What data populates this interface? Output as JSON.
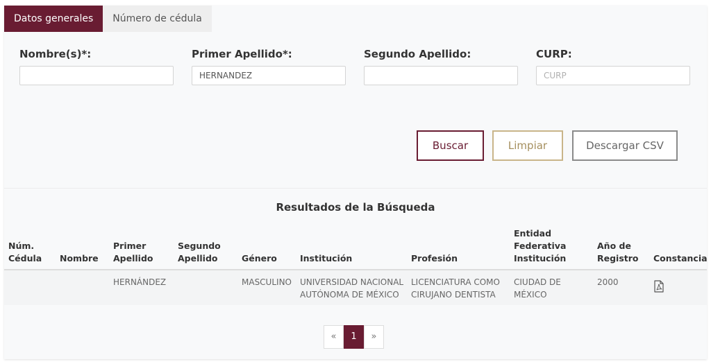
{
  "tabs": [
    {
      "label": "Datos generales",
      "active": true
    },
    {
      "label": "Número de cédula",
      "active": false
    }
  ],
  "form": {
    "nombre": {
      "label": "Nombre(s)*:",
      "value": "",
      "placeholder": ""
    },
    "primer_apellido": {
      "label": "Primer Apellido*:",
      "value": "HERNANDEZ",
      "placeholder": ""
    },
    "segundo_apellido": {
      "label": "Segundo Apellido:",
      "value": "",
      "placeholder": ""
    },
    "curp": {
      "label": "CURP:",
      "value": "",
      "placeholder": "CURP"
    }
  },
  "buttons": {
    "buscar": "Buscar",
    "limpiar": "Limpiar",
    "descargar_csv": "Descargar CSV"
  },
  "results": {
    "title": "Resultados de la Búsqueda",
    "columns": [
      [
        "Núm.",
        "Cédula"
      ],
      [
        "Nombre"
      ],
      [
        "Primer",
        "Apellido"
      ],
      [
        "Segundo",
        "Apellido"
      ],
      [
        "Género"
      ],
      [
        "Institución"
      ],
      [
        "Profesión"
      ],
      [
        "Entidad",
        "Federativa",
        "Institución"
      ],
      [
        "Año de",
        "Registro"
      ],
      [
        "Constancia"
      ]
    ],
    "rows": [
      {
        "cedula": "",
        "nombre": "",
        "primer_apellido": "HERNÁNDEZ",
        "segundo_apellido": "",
        "genero": "MASCULINO",
        "institucion": [
          "UNIVERSIDAD NACIONAL",
          "AUTÓNOMA DE MÉXICO"
        ],
        "profesion": [
          "LICENCIATURA COMO",
          "CIRUJANO DENTISTA"
        ],
        "entidad": [
          "CIUDAD DE",
          "MÉXICO"
        ],
        "anio": "2000",
        "constancia_icon": "pdf-file-icon"
      }
    ]
  },
  "pagination": {
    "prev": "«",
    "pages": [
      "1"
    ],
    "current": "1",
    "next": "»"
  },
  "colors": {
    "primary": "#691c32",
    "gold": "#c9b589",
    "gray": "#8a8a8a"
  }
}
